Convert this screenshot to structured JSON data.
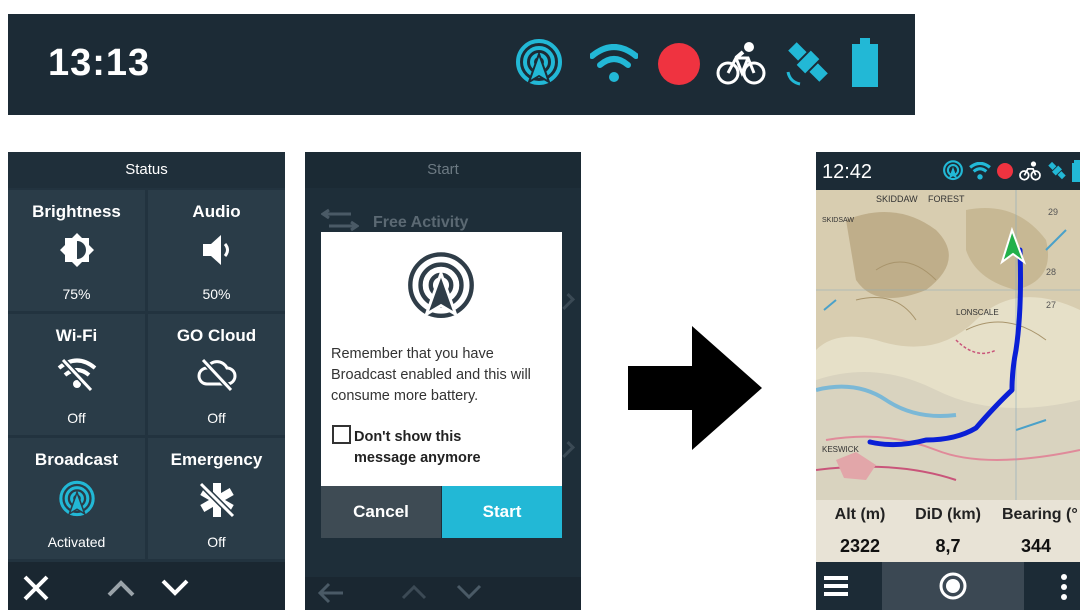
{
  "status_bar": {
    "time": "13:13",
    "icons": [
      "broadcast-icon",
      "wifi-icon",
      "record-dot-icon",
      "bike-icon",
      "satellite-icon",
      "battery-icon"
    ]
  },
  "status_panel": {
    "title": "Status",
    "tiles": [
      {
        "label": "Brightness",
        "value": "75%",
        "icon": "brightness-icon"
      },
      {
        "label": "Audio",
        "value": "50%",
        "icon": "speaker-icon"
      },
      {
        "label": "Wi-Fi",
        "value": "Off",
        "icon": "wifi-off-icon"
      },
      {
        "label": "GO Cloud",
        "value": "Off",
        "icon": "cloud-off-icon"
      },
      {
        "label": "Broadcast",
        "value": "Activated",
        "icon": "broadcast-icon"
      },
      {
        "label": "Emergency",
        "value": "Off",
        "icon": "emergency-off-icon"
      }
    ],
    "nav": [
      "close-icon",
      "chevron-up-icon",
      "chevron-down-icon"
    ]
  },
  "start_panel": {
    "title": "Start",
    "list_item": "Free Activity",
    "dialog": {
      "message": "Remember that you have Broadcast enabled and this will consume more battery.",
      "checkbox_label": "Don't show this message anymore",
      "cancel": "Cancel",
      "start": "Start"
    }
  },
  "map_device": {
    "time": "12:42",
    "map_labels": [
      "SKIDDAW",
      "FOREST",
      "SKIDSAW",
      "LONSCALE",
      "KESWICK",
      "29",
      "28",
      "27"
    ],
    "metrics": [
      {
        "label": "Alt (m)",
        "value": "2322"
      },
      {
        "label": "DiD (km)",
        "value": "8,7"
      },
      {
        "label": "Bearing (°",
        "value": "344"
      }
    ]
  },
  "colors": {
    "dark_bg": "#1c2b36",
    "accent": "#22b8d6",
    "record": "#ef3340",
    "route": "#0a1fd6"
  }
}
